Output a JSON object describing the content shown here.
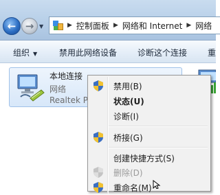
{
  "address_bar": {
    "back_icon": "back-arrow-icon",
    "forward_icon": "forward-arrow-icon",
    "breadcrumbs": [
      "控制面板",
      "网络和 Internet",
      "网络"
    ]
  },
  "toolbar": {
    "organize_label": "组织",
    "disable_label": "禁用此网络设备",
    "diagnose_label": "诊断这个连接",
    "rename_label": "重"
  },
  "adapter": {
    "name": "本地连接",
    "network": "网络",
    "device": "Realtek PC"
  },
  "context_menu": {
    "items": [
      {
        "label": "禁用(B)",
        "icon": "shield-icon"
      },
      {
        "label": "状态(U)",
        "bold": true
      },
      {
        "label": "诊断(I)"
      },
      {
        "label": "桥接(G)",
        "icon": "shield-icon"
      },
      {
        "label": "创建快捷方式(S)"
      },
      {
        "label": "删除(D)",
        "icon": "shield-icon",
        "disabled": true
      },
      {
        "label": "重命名(M)",
        "icon": "shield-icon"
      }
    ]
  },
  "colors": {
    "toolbar_gradient_top": "#f7fafd",
    "adapter_selected_bg": "#d7e7f9",
    "menu_bg": "#f1f1f1"
  }
}
